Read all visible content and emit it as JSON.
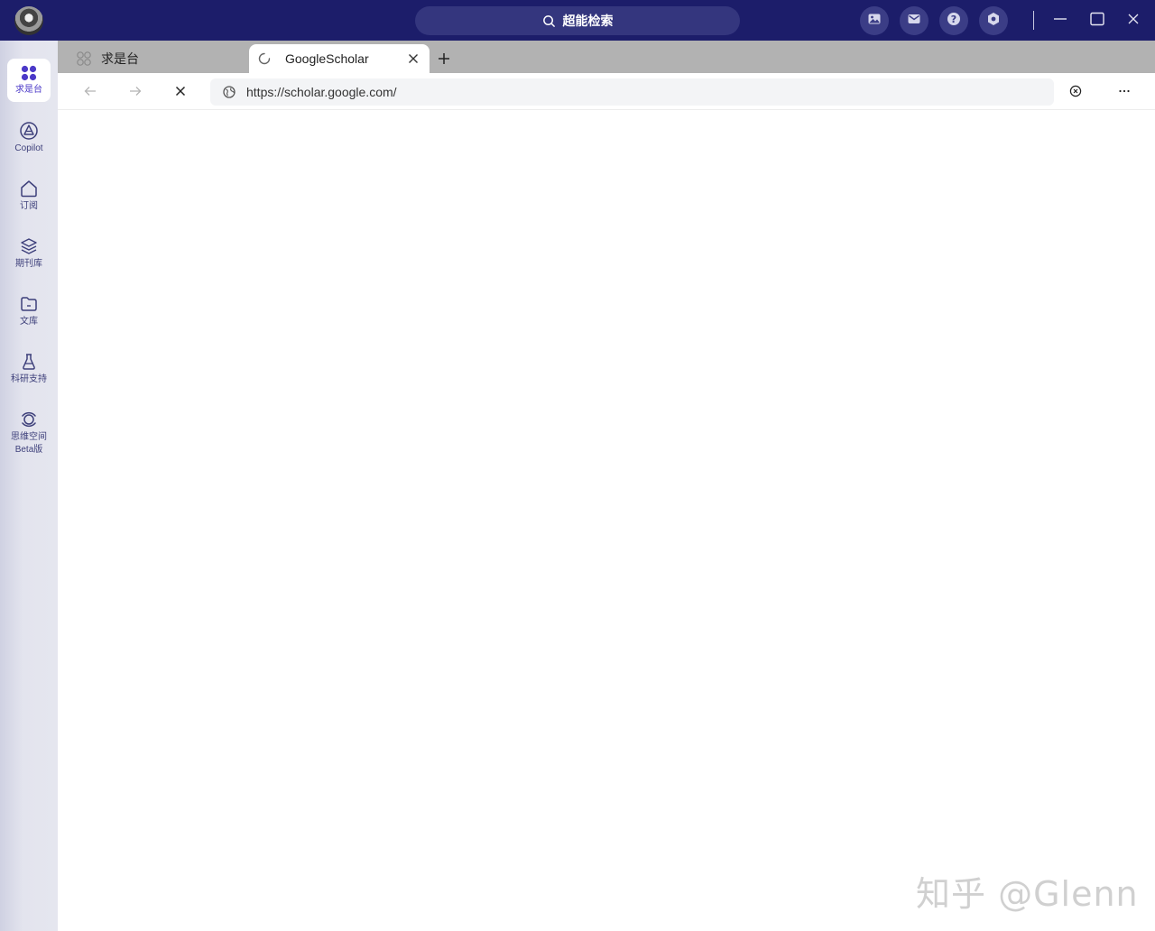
{
  "app": {
    "search_placeholder": "超能检索",
    "toolbar_icons": [
      "image-icon",
      "mail-icon",
      "help-icon",
      "settings-icon"
    ],
    "accent": "#1c1d6a",
    "active_accent": "#4b39c8"
  },
  "sidebar": {
    "items": [
      {
        "label": "求是台",
        "icon": "apps-icon"
      },
      {
        "label": "Copilot",
        "icon": "copilot-icon"
      },
      {
        "label": "订阅",
        "icon": "home-icon"
      },
      {
        "label": "期刊库",
        "icon": "layers-icon"
      },
      {
        "label": "文库",
        "icon": "folder-icon"
      },
      {
        "label": "科研支持",
        "icon": "flask-icon"
      },
      {
        "label": "思维空间",
        "label2": "Beta版",
        "icon": "orbit-icon"
      }
    ]
  },
  "tabs": [
    {
      "title": "求是台",
      "active": false
    },
    {
      "title": "GoogleScholar",
      "active": true,
      "loading": true
    }
  ],
  "address": {
    "url": "https://scholar.google.com/"
  },
  "watermark": "知乎 @Glenn"
}
